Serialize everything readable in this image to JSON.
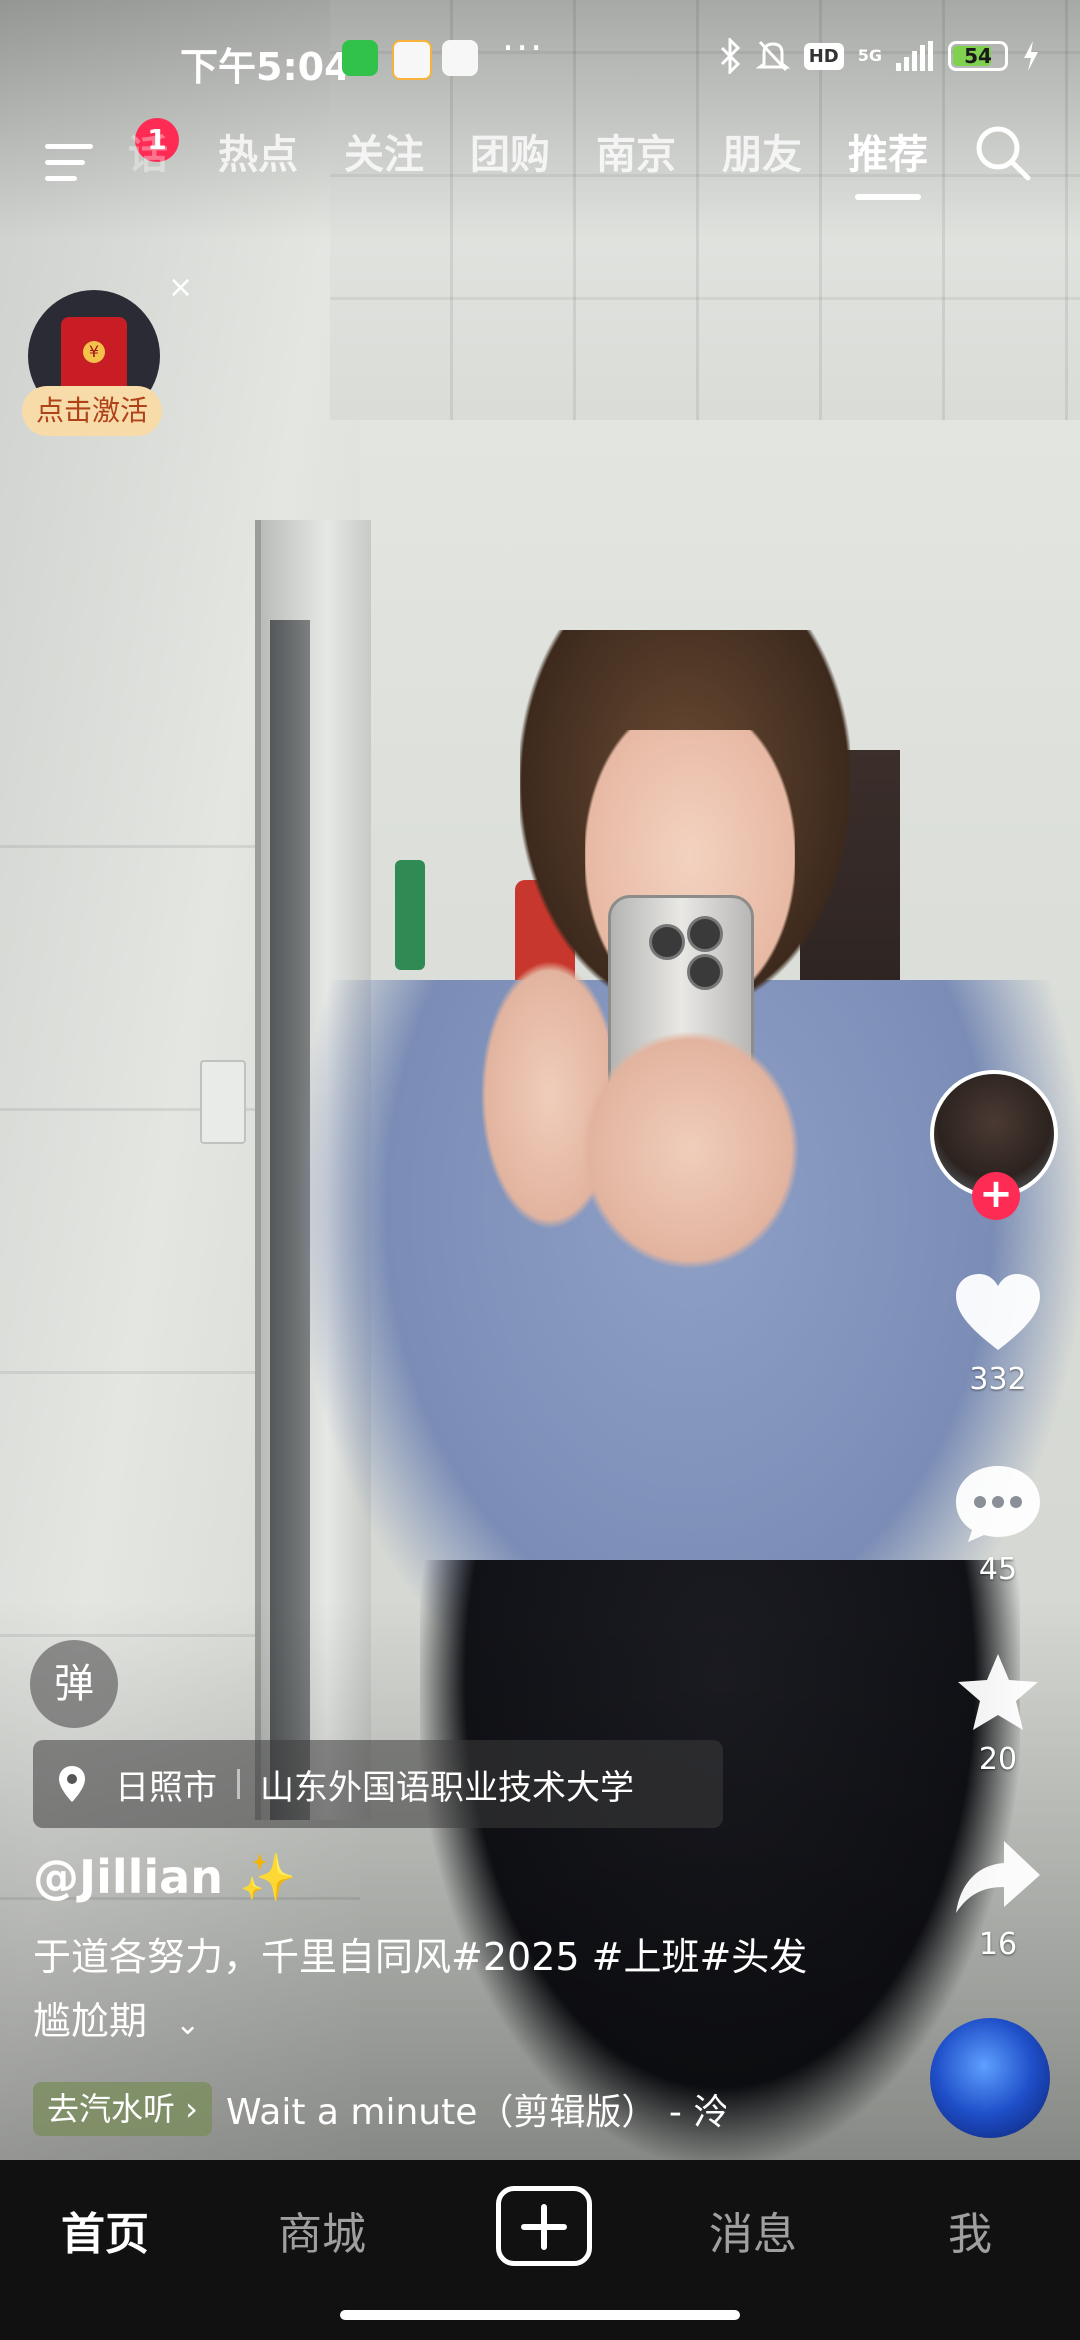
{
  "status_bar": {
    "time": "下午5:04",
    "dots": "···",
    "hd": "HD",
    "network": "5G",
    "battery": "54",
    "icons": [
      "wechat-icon",
      "58-app-icon",
      "cloud-app-icon",
      "bluetooth-icon",
      "mute-bell-icon",
      "signal-icon",
      "charging-icon"
    ]
  },
  "top_nav": {
    "notification_badge": "1",
    "faded_tab": "话",
    "tabs": [
      "热点",
      "关注",
      "团购",
      "南京",
      "朋友",
      "推荐"
    ],
    "active_tab": "推荐"
  },
  "red_packet": {
    "label": "点击激活",
    "close": "×"
  },
  "right_rail": {
    "likes": "332",
    "comments": "45",
    "favorites": "20",
    "shares": "16"
  },
  "video_info": {
    "danmu": "弹",
    "location_city": "日照市",
    "location_place": "山东外国语职业技术大学",
    "author": "@Jillian ✨",
    "caption": "于道各努力，千里自同风#2025 #上班#头发尴尬期",
    "music_chip": "去汽水听 ›",
    "music_title": "Wait a minute（剪辑版） - 泠"
  },
  "bottom_nav": {
    "items": [
      "首页",
      "商城",
      "消息",
      "我"
    ],
    "active": "首页"
  },
  "colors": {
    "accent": "#fe2c55",
    "battery": "#7fd14f",
    "redpacket_label_bg": "#f7dca9"
  }
}
